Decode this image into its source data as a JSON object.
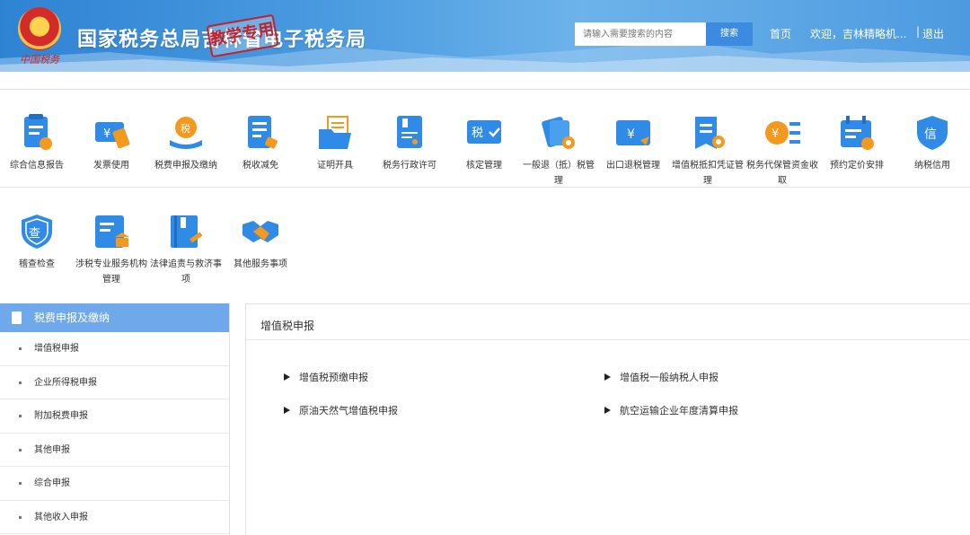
{
  "header": {
    "site_title": "国家税务总局吉林省电子税务局",
    "emblem_caption": "中国税务",
    "stamp_text": "教学专用",
    "search_placeholder": "请输入需要搜索的内容",
    "search_button": "搜索",
    "nav_home": "首页",
    "nav_welcome": "欢迎，吉林精略机...",
    "nav_separator": "|",
    "nav_logout": "退出"
  },
  "tiles": [
    {
      "label": "综合信息报告"
    },
    {
      "label": "发票使用"
    },
    {
      "label": "税费申报及缴纳"
    },
    {
      "label": "税收减免"
    },
    {
      "label": "证明开具"
    },
    {
      "label": "税务行政许可"
    },
    {
      "label": "核定管理",
      "icon_text": "税"
    },
    {
      "label": "一般退（抵）税管理"
    },
    {
      "label": "出口退税管理"
    },
    {
      "label": "增值税抵扣凭证管理"
    },
    {
      "label": "税务代保管资金收取"
    },
    {
      "label": "预约定价安排"
    },
    {
      "label": "纳税信用",
      "icon_text": "信"
    },
    {
      "label": "稽查检查",
      "icon_text": "查"
    },
    {
      "label": "涉税专业服务机构管理"
    },
    {
      "label": "法律追责与救济事项"
    },
    {
      "label": "其他服务事项"
    }
  ],
  "sidebar": {
    "title": "税费申报及缴纳",
    "items": [
      {
        "label": "增值税申报"
      },
      {
        "label": "企业所得税申报"
      },
      {
        "label": "附加税费申报"
      },
      {
        "label": "其他申报"
      },
      {
        "label": "综合申报"
      },
      {
        "label": "其他收入申报"
      }
    ]
  },
  "content": {
    "title": "增值税申报",
    "links": [
      {
        "label": "增值税预缴申报"
      },
      {
        "label": "增值税一般纳税人申报"
      },
      {
        "label": "原油天然气增值税申报"
      },
      {
        "label": "航空运输企业年度清算申报"
      }
    ]
  },
  "colors": {
    "icon_blue": "#2f8be6",
    "icon_orange": "#f39a1e",
    "header_blue": "#3f8fdc",
    "panel_head": "#6fa9ec"
  }
}
